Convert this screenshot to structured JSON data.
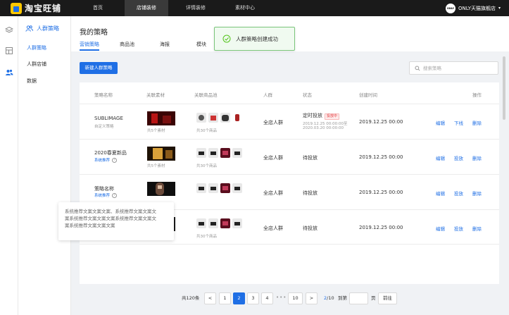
{
  "app": {
    "logo_text": "淘宝旺铺"
  },
  "topnav": {
    "items": [
      {
        "label": "首页"
      },
      {
        "label": "店铺装修"
      },
      {
        "label": "详情装修"
      },
      {
        "label": "素材中心"
      }
    ],
    "active_index": 1,
    "store_avatar": "ONLY",
    "store_name": "ONLY天猫旗舰店"
  },
  "rail": {
    "icons": [
      "layers-icon",
      "layout-icon",
      "users-icon"
    ],
    "active_index": 2
  },
  "submenu": {
    "title": "人群策略",
    "items": [
      {
        "label": "人群策略",
        "active": true
      },
      {
        "label": "人群店铺",
        "active": false
      },
      {
        "label": "数据",
        "active": false
      }
    ]
  },
  "page": {
    "title": "我的策略",
    "tabs": [
      {
        "label": "营销策略",
        "active": true
      },
      {
        "label": "商品池",
        "active": false
      },
      {
        "label": "海报",
        "active": false
      },
      {
        "label": "模块",
        "active": false
      }
    ]
  },
  "toast": {
    "text": "人群策略创建成功"
  },
  "toolbar": {
    "create_label": "新建人群策略",
    "search_placeholder": "搜索策略"
  },
  "table": {
    "headers": [
      "策略名称",
      "关联素材",
      "关联商品池",
      "人群",
      "状态",
      "创建时间",
      "操作"
    ],
    "rows": [
      {
        "name": "SUBLIMAGE",
        "name_sub": "自定义策略",
        "name_sub_blue": false,
        "help": false,
        "material_count": "共5个素材",
        "product_count": "共30个商品",
        "crowd": "全店人群",
        "status": "定时投放",
        "status_badge": "投放中",
        "status_time1": "2019.12.25 00:00:00至",
        "status_time2": "2020.03.20 00:00:00",
        "created": "2019.12.25 00:00",
        "actions": [
          "编辑",
          "下线",
          "删除"
        ]
      },
      {
        "name": "2020春夏新品",
        "name_sub": "系统推荐",
        "name_sub_blue": true,
        "help": true,
        "material_count": "共5个素材",
        "product_count": "共30个商品",
        "crowd": "全店人群",
        "status": "待投放",
        "status_badge": "",
        "status_time1": "",
        "status_time2": "",
        "created": "2019.12.25 00:00",
        "actions": [
          "编辑",
          "投放",
          "删除"
        ]
      },
      {
        "name": "策略名称",
        "name_sub": "系统推荐",
        "name_sub_blue": true,
        "help": true,
        "material_count": "",
        "product_count": "",
        "crowd": "全店人群",
        "status": "待投放",
        "status_badge": "",
        "status_time1": "",
        "status_time2": "",
        "created": "2019.12.25 00:00",
        "actions": [
          "编辑",
          "投放",
          "删除"
        ]
      },
      {
        "name": "",
        "name_sub": "",
        "name_sub_blue": false,
        "help": false,
        "material_count": "",
        "product_count": "共30个商品",
        "crowd": "全店人群",
        "status": "待投放",
        "status_badge": "",
        "status_time1": "",
        "status_time2": "",
        "created": "2019.12.25 00:00",
        "actions": [
          "编辑",
          "投放",
          "删除"
        ]
      }
    ]
  },
  "tooltip": {
    "lines": [
      "系统推荐文案文案文案、系统推荐文案文案文",
      "案系统推荐文案文案文案系统推荐文案文案文",
      "案系统推荐文案文案文案"
    ]
  },
  "pagination": {
    "total": "共120条",
    "prev": "<",
    "next": ">",
    "pages": [
      "1",
      "2",
      "3",
      "4",
      "10"
    ],
    "current": "2",
    "ellipsis": "•••",
    "page_count_current": "2",
    "page_count_total": "/10",
    "goto_label": "到第",
    "goto_value": "",
    "page_suffix": "页",
    "goto_button": "前往"
  },
  "colors": {
    "accent": "#1f6fe5",
    "topbar": "#1a1a1a",
    "success": "#52c41a",
    "danger": "#e4393c"
  }
}
